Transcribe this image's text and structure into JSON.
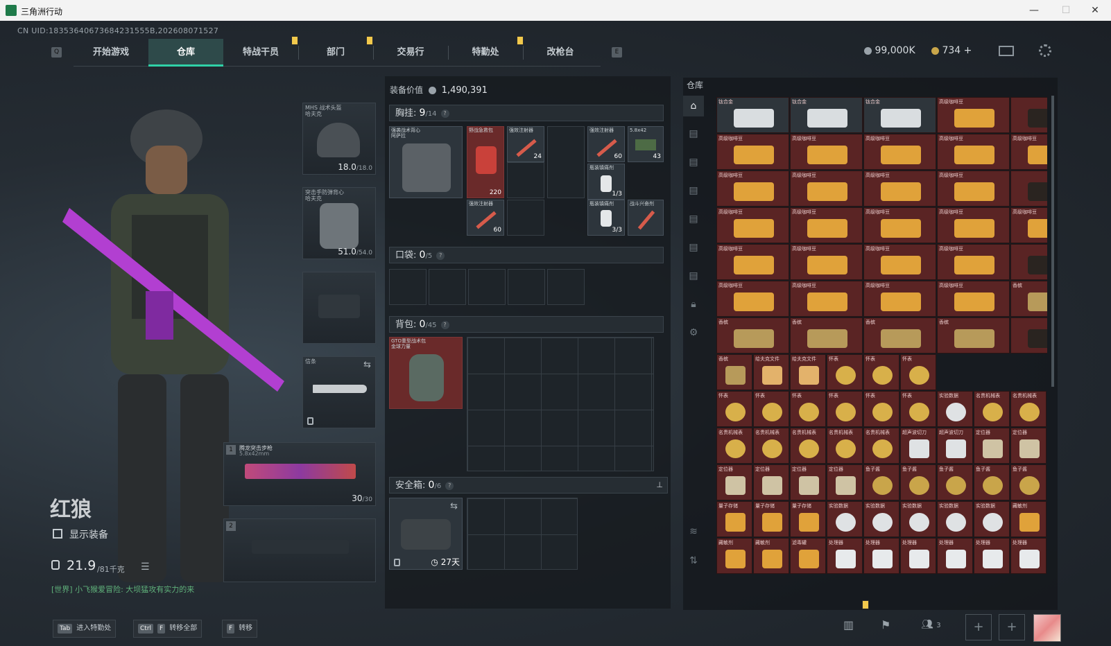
{
  "window": {
    "title": "三角洲行动",
    "min": "—",
    "max": "☐",
    "close": "✕"
  },
  "uid": "CN UID:18353640673684231555B,202608071527",
  "nav": {
    "left_key": "Q",
    "right_key": "E",
    "tabs": [
      "开始游戏",
      "仓库",
      "特战干员",
      "部门",
      "交易行",
      "特勤处",
      "改枪台"
    ],
    "active": 1
  },
  "currency": {
    "silver": "99,000K",
    "gold": "734",
    "plus": "+"
  },
  "operator": {
    "name": "红狼",
    "show_gear": "显示装备",
    "weight": "21.9",
    "weight_max": "/81千克",
    "chat": "[世界] 小飞猴爱冒险: 大坝猛攻有实力的来"
  },
  "gear": {
    "helmet": {
      "label": "MHS 战术头盔\n哈夫克",
      "val": "18.0",
      "max": "/18.0"
    },
    "armor": {
      "label": "突击手防弹背心\n哈夫克",
      "val": "51.0",
      "max": "/54.0"
    },
    "melee": {
      "label": "信条"
    },
    "primary": {
      "slot": "1",
      "label": "腾龙突击步枪",
      "ammo": "5.8x42mm",
      "count": "30",
      "max": "/30"
    },
    "secondary": {
      "slot": "2"
    }
  },
  "equip": {
    "value_label": "装备价值",
    "value": "1,490,391"
  },
  "chest": {
    "title": "胸挂:",
    "count": "9",
    "max": "/14",
    "rig": "强袭战术背心\n阿萨拉",
    "items": [
      {
        "label": "野战急救包",
        "qty": "220"
      },
      {
        "label": "强效注射器",
        "qty": "24"
      },
      {
        "label": "强效注射器",
        "qty": "60"
      },
      {
        "label": "5.8x42",
        "qty": "43"
      },
      {
        "label": "瓶装镇痛剂",
        "qty": "1/3"
      },
      {
        "label": "强效注射器",
        "qty": "60"
      },
      {
        "label": "瓶装镇痛剂",
        "qty": "3/3"
      },
      {
        "label": "战斗兴奋剂",
        "qty": ""
      }
    ]
  },
  "pocket": {
    "title": "口袋:",
    "count": "0",
    "max": "/5"
  },
  "backpack": {
    "title": "背包:",
    "count": "0",
    "max": "/45",
    "bag": "GTO重型战术包\n金球力量"
  },
  "safebox": {
    "title": "安全箱:",
    "count": "0",
    "max": "/6",
    "days": "27天"
  },
  "stash": {
    "title": "仓库",
    "rows": [
      [
        "钛合金",
        "钛合金",
        "钛合金",
        "高级咖啡豆",
        ""
      ],
      [
        "高级咖啡豆",
        "高级咖啡豆",
        "高级咖啡豆",
        "高级咖啡豆",
        "高级咖啡豆"
      ],
      [
        "高级咖啡豆",
        "高级咖啡豆",
        "高级咖啡豆",
        "高级咖啡豆",
        ""
      ],
      [
        "高级咖啡豆",
        "高级咖啡豆",
        "高级咖啡豆",
        "高级咖啡豆",
        "高级咖啡豆"
      ],
      [
        "高级咖啡豆",
        "高级咖啡豆",
        "高级咖啡豆",
        "高级咖啡豆",
        ""
      ],
      [
        "高级咖啡豆",
        "高级咖啡豆",
        "高级咖啡豆",
        "高级咖啡豆",
        "香槟"
      ],
      [
        "香槟",
        "香槟",
        "香槟",
        "香槟",
        ""
      ],
      [
        "香槟",
        "给夫克文件",
        "给夫克文件",
        "怀表",
        "怀表",
        "怀表"
      ],
      [
        "怀表",
        "怀表",
        "怀表",
        "怀表",
        "怀表",
        "怀表",
        "实验数据",
        "名贵机械表",
        "名贵机械表"
      ],
      [
        "名贵机械表",
        "名贵机械表",
        "名贵机械表",
        "名贵机械表",
        "名贵机械表",
        "超声波切刀",
        "超声波切刀",
        "定位器",
        "定位器"
      ],
      [
        "定位器",
        "定位器",
        "定位器",
        "定位器",
        "鱼子酱",
        "鱼子酱",
        "鱼子酱",
        "鱼子酱",
        "鱼子酱"
      ],
      [
        "量子存储",
        "量子存储",
        "量子存储",
        "实验数据",
        "实验数据",
        "实验数据",
        "实验数据",
        "实验数据",
        "藏敏剂"
      ],
      [
        "藏敏剂",
        "藏敏剂",
        "滤毒罐",
        "处理器",
        "处理器",
        "处理器",
        "处理器",
        "处理器",
        "处理器"
      ]
    ]
  },
  "bottom": {
    "tab_key": "Tab",
    "tab_label": "进入特勤处",
    "ctrl_key": "Ctrl",
    "f_key": "F",
    "ctrlf_label": "转移全部",
    "f2_key": "F",
    "f_label": "转移",
    "squad": "3",
    "plus": "+"
  },
  "colors": {
    "accent": "#2fd1a7",
    "item_red": "#5a2424",
    "bg": "#1c2126"
  }
}
